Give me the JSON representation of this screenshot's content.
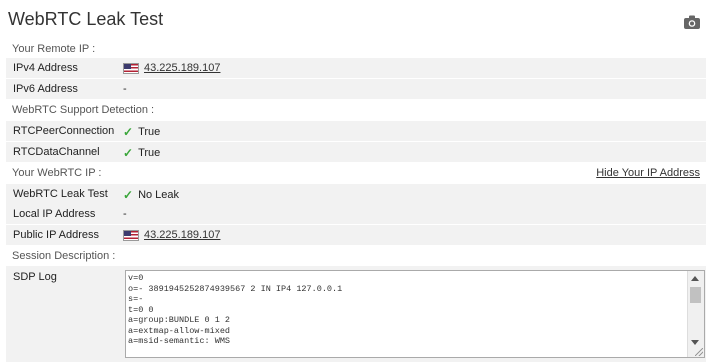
{
  "page_title": "WebRTC Leak Test",
  "icons": {
    "camera": "camera-icon",
    "flag": "us-flag-icon",
    "check": "check-icon"
  },
  "colors": {
    "check": "#3aa63a",
    "row_bg": "#f2f2f2"
  },
  "remote_ip": {
    "section_label": "Your Remote IP :",
    "ipv4_label": "IPv4 Address",
    "ipv4_value": "43.225.189.107",
    "ipv6_label": "IPv6 Address",
    "ipv6_value": "-"
  },
  "support": {
    "section_label": "WebRTC Support Detection :",
    "peer_label": "RTCPeerConnection",
    "peer_value": "True",
    "channel_label": "RTCDataChannel",
    "channel_value": "True"
  },
  "webrtc_ip": {
    "section_label": "Your WebRTC IP :",
    "hide_link": "Hide Your IP Address",
    "leak_label": "WebRTC Leak Test",
    "leak_value": "No Leak",
    "local_label": "Local IP Address",
    "local_value": "-",
    "public_label": "Public IP Address",
    "public_value": "43.225.189.107"
  },
  "session": {
    "section_label": "Session Description :",
    "sdp_label": "SDP Log",
    "sdp_lines": [
      "v=0",
      "o=- 3891945252874939567 2 IN IP4 127.0.0.1",
      "s=-",
      "t=0 0",
      "a=group:BUNDLE 0 1 2",
      "a=extmap-allow-mixed",
      "a=msid-semantic: WMS"
    ]
  }
}
